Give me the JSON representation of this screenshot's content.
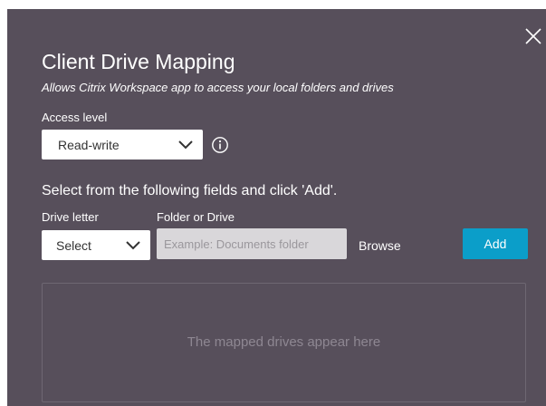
{
  "dialog": {
    "title": "Client Drive Mapping",
    "subtitle": "Allows Citrix Workspace app to access your local folders and drives",
    "background_color": "#574f5b"
  },
  "close_icon": "close-icon",
  "access_level": {
    "label": "Access level",
    "selected": "Read-write",
    "info_icon": "info-icon"
  },
  "instruction": "Select from the following fields and click 'Add'.",
  "drive_letter": {
    "label": "Drive letter",
    "selected": "Select"
  },
  "folder": {
    "label": "Folder or Drive",
    "value": "",
    "placeholder": "Example: Documents folder"
  },
  "browse_label": "Browse",
  "add_label": "Add",
  "add_color": "#0b9ec9",
  "mapped_drives": {
    "placeholder": "The mapped drives appear here"
  }
}
